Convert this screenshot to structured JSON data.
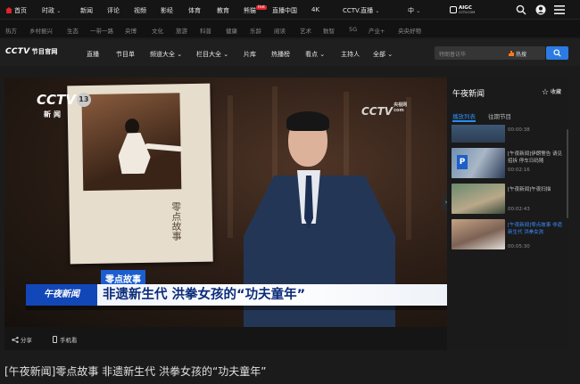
{
  "top_nav": {
    "items": [
      "首页",
      "时政",
      "新闻",
      "评论",
      "视频",
      "影经",
      "体育",
      "教育",
      "熊猫",
      "直播中国",
      "4K",
      "CCTV.直播",
      "中"
    ],
    "hot_badge": "Hot",
    "aigc": {
      "title": "AIGC",
      "subtitle": "CCTV.COM"
    }
  },
  "sub_nav": {
    "items": [
      "热方",
      "乡村振兴",
      "生态",
      "一带一路",
      "央博",
      "文化",
      "旅游",
      "科普",
      "健康",
      "乐龄",
      "阅读",
      "艺术",
      "数智",
      "5G",
      "产业+",
      "央央好物"
    ]
  },
  "channel_nav": {
    "logo": "CCTV",
    "logo_sub": "节目官网",
    "items": [
      "直播",
      "节目单",
      "频道大全",
      "栏目大全",
      "片库",
      "热播榜",
      "看点",
      "主持人",
      "全部"
    ],
    "search_placeholder": "特朗普访华",
    "hot_label": "热搜"
  },
  "player": {
    "watermark_left": "CCTV",
    "watermark_channel": "13",
    "watermark_left_sub": "新闻",
    "watermark_right": "CCTV",
    "watermark_right_domain": "央视网",
    "watermark_right_com": "com",
    "frame_text": "零点故事",
    "segment_tag": "零点故事",
    "program_logo": "午夜新闻",
    "headline": "非遗新生代 洪拳女孩的“功夫童年”"
  },
  "controls": {
    "share": "分享",
    "phone": "手机看"
  },
  "sidebar": {
    "title": "午夜新闻",
    "collect": "收藏",
    "tabs": [
      "播放列表",
      "往期节目"
    ],
    "videos": [
      {
        "title": "",
        "duration": "00:00:38",
        "active": false
      },
      {
        "title": "[午夜新闻]伊朗警告 请见招拆 停车日码随",
        "duration": "00:02:16",
        "active": false
      },
      {
        "title": "[午夜新闻]午夜扫描",
        "duration": "00:02:43",
        "active": false
      },
      {
        "title": "[午夜新闻]零点故事 非遗新生代 洪拳女孩",
        "duration": "00:05:30",
        "active": true
      }
    ]
  },
  "page_title": "[午夜新闻]零点故事 非遗新生代 洪拳女孩的“功夫童年”",
  "colors": {
    "accent": "#2d8cf0",
    "brand_red": "#e4252b",
    "headline": "#0c2c7a"
  }
}
